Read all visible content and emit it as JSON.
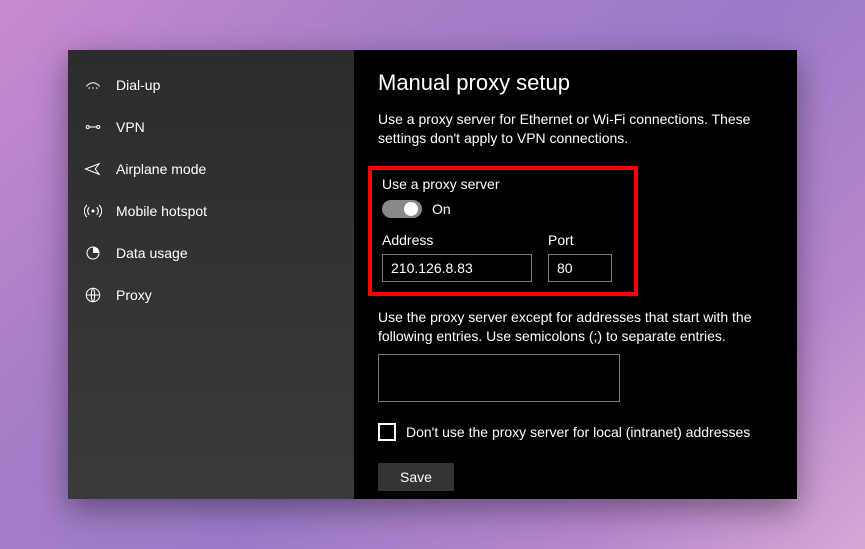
{
  "sidebar": {
    "items": [
      {
        "icon": "dialup-icon",
        "label": "Dial-up"
      },
      {
        "icon": "vpn-icon",
        "label": "VPN"
      },
      {
        "icon": "airplane-icon",
        "label": "Airplane mode"
      },
      {
        "icon": "hotspot-icon",
        "label": "Mobile hotspot"
      },
      {
        "icon": "data-usage-icon",
        "label": "Data usage"
      },
      {
        "icon": "proxy-icon",
        "label": "Proxy"
      }
    ]
  },
  "content": {
    "title": "Manual proxy setup",
    "description": "Use a proxy server for Ethernet or Wi-Fi connections. These settings don't apply to VPN connections.",
    "use_proxy_label": "Use a proxy server",
    "toggle_state_label": "On",
    "toggle_on": true,
    "address_label": "Address",
    "address_value": "210.126.8.83",
    "port_label": "Port",
    "port_value": "80",
    "except_label": "Use the proxy server except for addresses that start with the following entries. Use semicolons (;) to separate entries.",
    "except_value": "",
    "local_checkbox_label": "Don't use the proxy server for local (intranet) addresses",
    "local_checked": false,
    "save_label": "Save"
  }
}
